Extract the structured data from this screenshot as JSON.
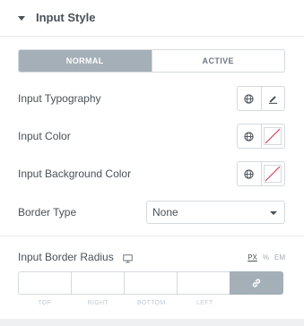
{
  "section": {
    "title": "Input Style",
    "toggle_icon": "caret-down-icon"
  },
  "tabs": [
    {
      "label": "NORMAL",
      "active": true
    },
    {
      "label": "ACTIVE",
      "active": false
    }
  ],
  "controls": {
    "typography": {
      "label": "Input Typography",
      "global_icon": "globe-icon",
      "edit_icon": "pencil-icon"
    },
    "color": {
      "label": "Input Color",
      "global_icon": "globe-icon",
      "value": "none"
    },
    "bg_color": {
      "label": "Input Background Color",
      "global_icon": "globe-icon",
      "value": "none"
    },
    "border_type": {
      "label": "Border Type",
      "value": "None",
      "options": [
        "None"
      ]
    }
  },
  "border_radius": {
    "label": "Input Border Radius",
    "device_icon": "desktop-icon",
    "units": [
      "PX",
      "%",
      "EM"
    ],
    "selected_unit": "PX",
    "fields": [
      {
        "label": "TOP",
        "value": ""
      },
      {
        "label": "RIGHT",
        "value": ""
      },
      {
        "label": "BOTTOM",
        "value": ""
      },
      {
        "label": "LEFT",
        "value": ""
      }
    ],
    "link_icon": "link-icon",
    "linked": true
  },
  "colors": {
    "accent": "#a4afb7",
    "text": "#495157",
    "border": "#d5dadf",
    "no_color_slash": "#d72b3f"
  }
}
